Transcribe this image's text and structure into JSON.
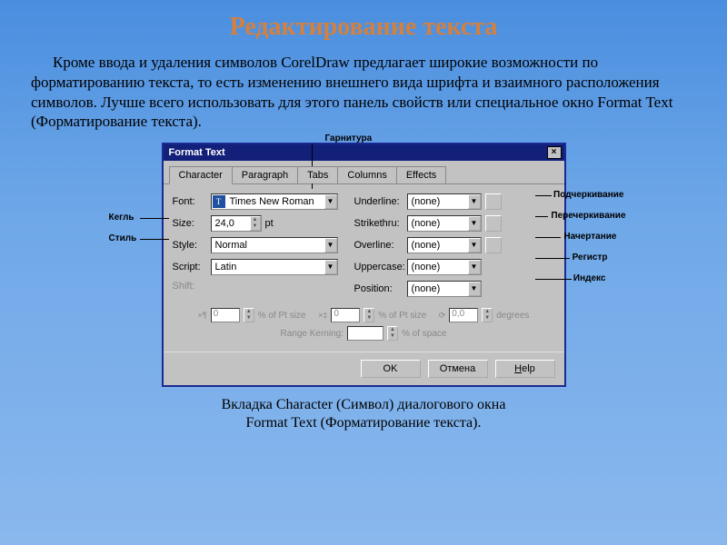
{
  "page": {
    "title": "Редактирование текста",
    "paragraph": "Кроме ввода и удаления символов CorelDraw предлагает широкие возможности по форматированию текста, то есть изменению внешнего вида шрифта и взаимного расположения символов. Лучше всего использовать для этого панель свойств или специальное окно Format Text (Форматирование текста).",
    "caption_l1": "Вкладка Character (Символ) диалогового окна",
    "caption_l2": "Format Text (Форматирование текста)."
  },
  "dialog": {
    "title": "Format Text",
    "tabs": [
      "Character",
      "Paragraph",
      "Tabs",
      "Columns",
      "Effects"
    ],
    "left": {
      "font_label": "Font:",
      "font_value": "Times New Roman",
      "size_label": "Size:",
      "size_value": "24,0",
      "size_unit": "pt",
      "style_label": "Style:",
      "style_value": "Normal",
      "script_label": "Script:",
      "script_value": "Latin",
      "shift_label": "Shift:"
    },
    "right": {
      "underline_label": "Underline:",
      "strikethru_label": "Strikethru:",
      "overline_label": "Overline:",
      "uppercase_label": "Uppercase:",
      "position_label": "Position:",
      "none": "(none)"
    },
    "disabled": {
      "v1": "0",
      "t1": "% of Pt size",
      "v2": "0",
      "t2": "% of Pt size",
      "v3": "0,0",
      "t3": "degrees",
      "rk": "Range Kerning:",
      "rk_t": "% of space"
    },
    "buttons": {
      "ok": "OK",
      "cancel": "Отмена",
      "help": "Help"
    }
  },
  "callouts": {
    "garnitura": "Гарнитура",
    "kegl": "Кегль",
    "stil": "Стиль",
    "podcherk": "Подчеркивание",
    "perecherk": "Перечеркивание",
    "nachert": "Начертание",
    "registr": "Регистр",
    "indeks": "Индекс"
  }
}
